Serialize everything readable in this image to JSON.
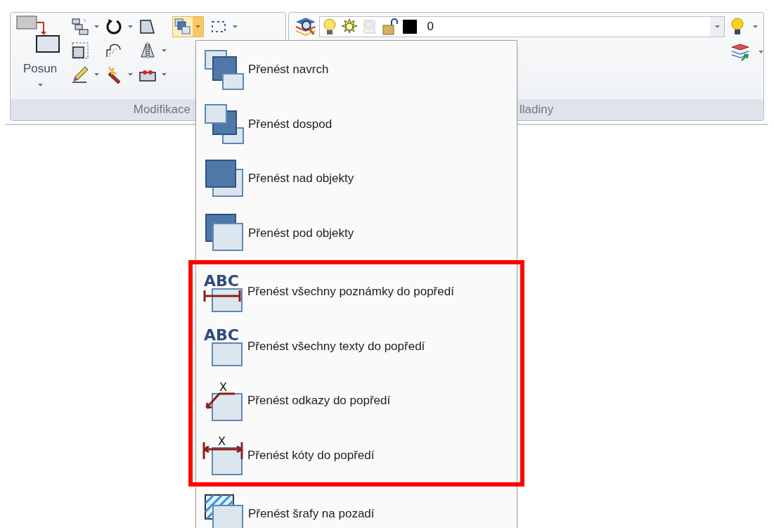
{
  "ribbon": {
    "panels": [
      {
        "kind": "modify",
        "label": "Modifikace",
        "big_button": {
          "label": "Posun"
        },
        "order_button": {
          "pressed": true
        }
      },
      {
        "kind": "layers",
        "label": "lladiny",
        "layer_combo": {
          "value": "0"
        }
      }
    ]
  },
  "menu": {
    "items": [
      {
        "kind": "front",
        "label": "Přenést navrch",
        "highlighted": false
      },
      {
        "kind": "back",
        "label": "Přenést dospod",
        "highlighted": false
      },
      {
        "kind": "above",
        "label": "Přenést nad objekty",
        "highlighted": false
      },
      {
        "kind": "below",
        "label": "Přenést pod objekty",
        "highlighted": false
      },
      {
        "kind": "notes",
        "icon_text": "ABC",
        "label": "Přenést všechny poznámky do popředí",
        "highlighted": true
      },
      {
        "kind": "texts",
        "icon_text": "ABC",
        "label": "Přenést všechny texty do popředí",
        "highlighted": true
      },
      {
        "kind": "leaders",
        "icon_text": "X",
        "label": "Přenést odkazy do popředí",
        "highlighted": true
      },
      {
        "kind": "dims",
        "icon_text": "X",
        "label": "Přenést kóty do popředí",
        "highlighted": true
      },
      {
        "kind": "hatch",
        "label": "Přenést šrafy na pozadí",
        "highlighted": false
      }
    ]
  }
}
